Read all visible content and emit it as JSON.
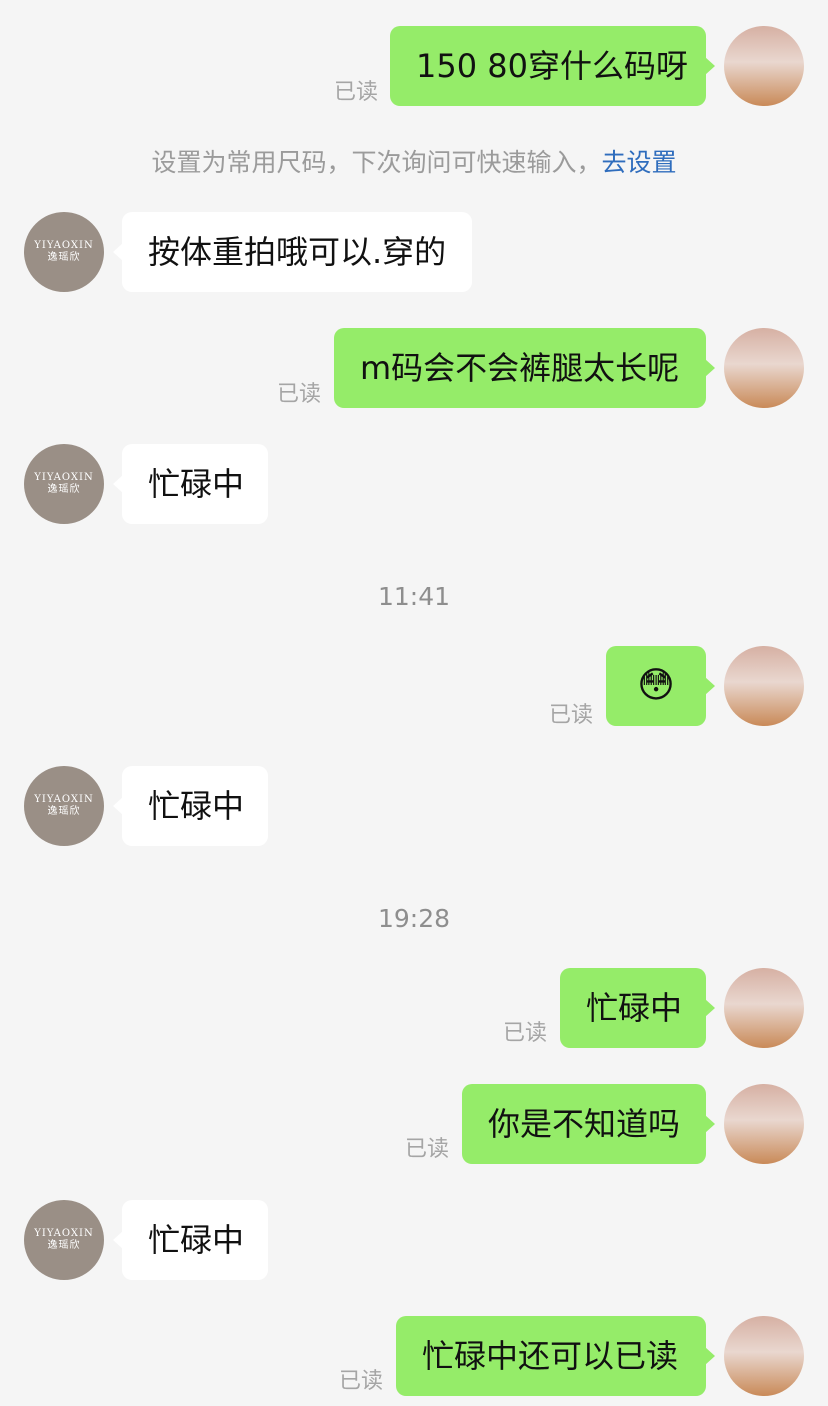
{
  "read_label": "已读",
  "system_notice": {
    "text": "设置为常用尺码，下次询问可快速输入，",
    "link": "去设置"
  },
  "merchant": {
    "brand_en": "YIYAOXIN",
    "brand_cn": "逸瑶欣"
  },
  "messages": [
    {
      "text": "150 80穿什么码呀"
    },
    {
      "text": "按体重拍哦可以.穿的"
    },
    {
      "text": "m码会不会裤腿太长呢"
    },
    {
      "text": "忙碌中"
    },
    {
      "time": "11:41"
    },
    {
      "emoji": "😳"
    },
    {
      "text": "忙碌中"
    },
    {
      "time": "19:28"
    },
    {
      "text": "忙碌中"
    },
    {
      "text": "你是不知道吗"
    },
    {
      "text": "忙碌中"
    },
    {
      "text": "忙碌中还可以已读"
    }
  ]
}
